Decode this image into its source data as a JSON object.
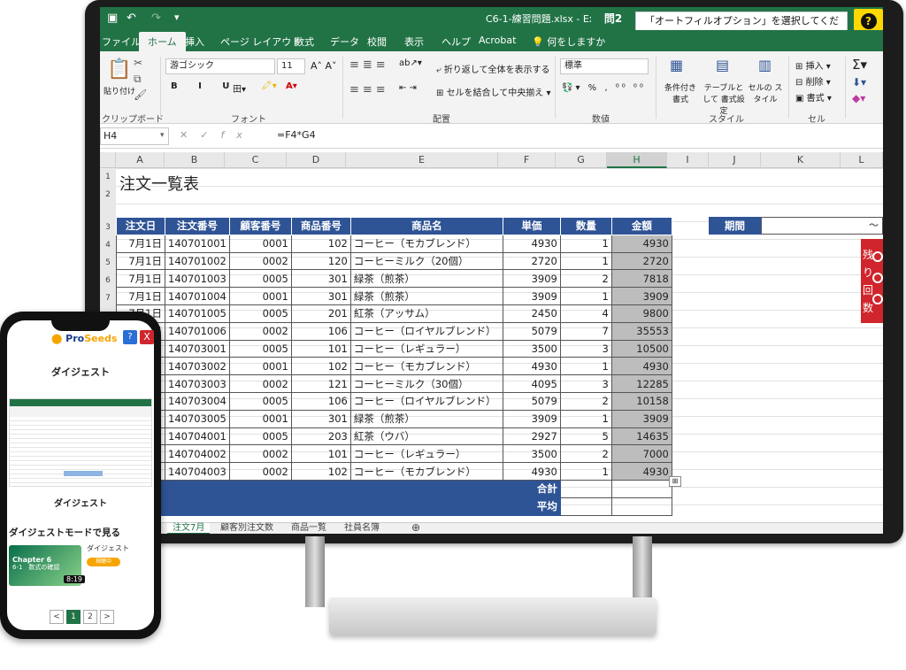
{
  "excel": {
    "title_bar": {
      "file_name": "C6-1-練習問題.xlsx - Exce"
    },
    "question": {
      "number": "問2",
      "text": "「オートフィルオプション」を選択してください。",
      "help_label": "?"
    },
    "tabs": [
      "ファイル",
      "ホーム",
      "挿入",
      "ページ レイアウト",
      "数式",
      "データ",
      "校閲",
      "表示",
      "ヘルプ",
      "Acrobat",
      "何をしますか"
    ],
    "active_tab": "ホーム",
    "ribbon": {
      "paste_label": "貼り付け",
      "font_name": "游ゴシック",
      "font_size": "11",
      "wrap_text": "折り返して全体を表示する",
      "merge_center": "セルを結合して中央揃え",
      "number_format": "標準",
      "cond_format": "条件付き 書式",
      "table_format": "テーブルとして 書式設定",
      "cell_style": "セルの スタイル",
      "insert": "挿入",
      "delete": "削除",
      "format": "書式",
      "groups": {
        "clipboard": "クリップボード",
        "font": "フォント",
        "alignment": "配置",
        "number": "数値",
        "style": "スタイル",
        "cells": "セル"
      }
    },
    "formula_bar": {
      "name_box": "H4",
      "fx": "fx",
      "formula": "=F4*G4"
    },
    "columns": [
      "A",
      "B",
      "C",
      "D",
      "E",
      "F",
      "G",
      "H",
      "I",
      "J",
      "K",
      "L"
    ],
    "selected_column": "H",
    "rows": [
      "1",
      "2",
      "3",
      "4",
      "5",
      "6",
      "7",
      "8",
      "9",
      "10",
      "11",
      "12",
      "13",
      "14",
      "15",
      "16",
      "17",
      "18",
      "19",
      "20"
    ],
    "sheet_title": "注文一覧表",
    "table": {
      "headers": [
        "注文日",
        "注文番号",
        "顧客番号",
        "商品番号",
        "商品名",
        "単価",
        "数量",
        "金額"
      ],
      "rows": [
        [
          "7月1日",
          "140701001",
          "0001",
          "102",
          "コーヒー（モカブレンド）",
          "4930",
          "1",
          "4930"
        ],
        [
          "7月1日",
          "140701002",
          "0002",
          "120",
          "コーヒーミルク（20個）",
          "2720",
          "1",
          "2720"
        ],
        [
          "7月1日",
          "140701003",
          "0005",
          "301",
          "緑茶（煎茶）",
          "3909",
          "2",
          "7818"
        ],
        [
          "7月1日",
          "140701004",
          "0001",
          "301",
          "緑茶（煎茶）",
          "3909",
          "1",
          "3909"
        ],
        [
          "7月1日",
          "140701005",
          "0005",
          "201",
          "紅茶（アッサム）",
          "2450",
          "4",
          "9800"
        ],
        [
          "7月1日",
          "140701006",
          "0002",
          "106",
          "コーヒー（ロイヤルブレンド）",
          "5079",
          "7",
          "35553"
        ],
        [
          "7月1日",
          "140703001",
          "0005",
          "101",
          "コーヒー（レギュラー）",
          "3500",
          "3",
          "10500"
        ],
        [
          "7月1日",
          "140703002",
          "0001",
          "102",
          "コーヒー（モカブレンド）",
          "4930",
          "1",
          "4930"
        ],
        [
          "7月1日",
          "140703003",
          "0002",
          "121",
          "コーヒーミルク（30個）",
          "4095",
          "3",
          "12285"
        ],
        [
          "7月1日",
          "140703004",
          "0005",
          "106",
          "コーヒー（ロイヤルブレンド）",
          "5079",
          "2",
          "10158"
        ],
        [
          "7月1日",
          "140703005",
          "0001",
          "301",
          "緑茶（煎茶）",
          "3909",
          "1",
          "3909"
        ],
        [
          "7月1日",
          "140704001",
          "0005",
          "203",
          "紅茶（ウバ）",
          "2927",
          "5",
          "14635"
        ],
        [
          "7月1日",
          "140704002",
          "0002",
          "101",
          "コーヒー（レギュラー）",
          "3500",
          "2",
          "7000"
        ],
        [
          "7月1日",
          "140704003",
          "0002",
          "102",
          "コーヒー（モカブレンド）",
          "4930",
          "1",
          "4930"
        ]
      ],
      "total_label": "合計",
      "average_label": "平均"
    },
    "period_label": "期間",
    "period_value": "～",
    "remaining_label": "残り回数",
    "sheet_tabs": [
      "注文7月",
      "顧客別注文数",
      "商品一覧",
      "社員名簿"
    ],
    "active_sheet": "注文7月"
  },
  "phone": {
    "logo_main": "Pro",
    "logo_accent": "Seeds",
    "help_label": "?",
    "close_label": "X",
    "digest_title": "ダイジェスト",
    "digest_caption": "ダイジェスト",
    "digest_mode_label": "ダイジェストモードで見る",
    "card_chapter": "Chapter 6",
    "card_subtitle": "6-1　数式の確認",
    "card_duration": "8:19",
    "card_caption": "ダイジェスト",
    "watch_label": "視聴中",
    "pagination": {
      "prev": "<",
      "pages": [
        "1",
        "2"
      ],
      "current": "1",
      "next": ">"
    }
  }
}
